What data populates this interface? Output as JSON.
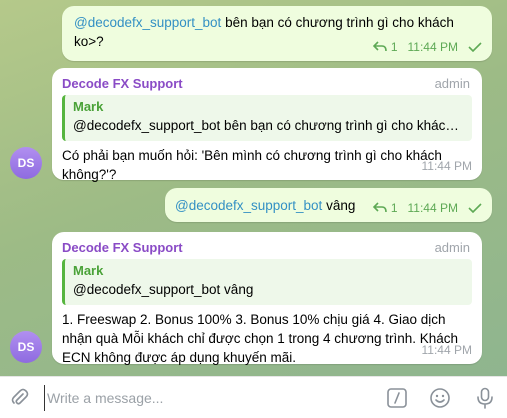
{
  "messages": [
    {
      "mention": "@decodefx_support_bot",
      "text": " bên bạn có chương trình gì cho khách ko>?",
      "reply_count": "1",
      "time": "11:44 PM"
    },
    {
      "sender": "Decode FX Support",
      "role": "admin",
      "quote_name": "Mark",
      "quote_text": "@decodefx_support_bot bên bạn có chương trình gì cho khác…",
      "text": "Có phải bạn muốn hỏi: 'Bên mình có chương trình gì cho khách không?'?",
      "time": "11:44 PM",
      "avatar": "DS"
    },
    {
      "mention": "@decodefx_support_bot",
      "text": " vâng",
      "reply_count": "1",
      "time": "11:44 PM"
    },
    {
      "sender": "Decode FX Support",
      "role": "admin",
      "quote_name": "Mark",
      "quote_text": "@decodefx_support_bot vâng",
      "text": "1. Freeswap 2. Bonus 100% 3. Bonus 10% chịu giá 4. Giao dịch nhận quà Mỗi khách chỉ được chọn 1 trong 4 chương trình. Khách ECN không được áp dụng khuyến mãi.",
      "time": "11:44 PM",
      "avatar": "DS"
    }
  ],
  "composer": {
    "placeholder": "Write a message...",
    "icons": [
      "paperclip-icon",
      "slash-command-icon",
      "emoji-icon",
      "microphone-icon"
    ]
  },
  "colors": {
    "outgoing_bubble": "#effdde",
    "incoming_bubble": "#ffffff",
    "sender_name": "#8a4bc6",
    "quote_accent": "#56b53f",
    "mention": "#3390c4",
    "avatar": "#9c7ae8"
  }
}
